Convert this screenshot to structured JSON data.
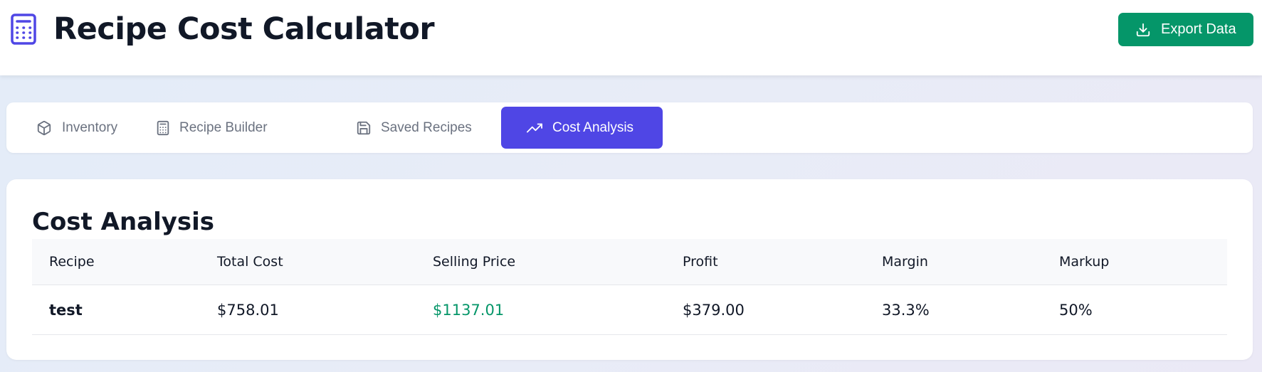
{
  "header": {
    "title": "Recipe Cost Calculator",
    "export_label": "Export Data",
    "app_icon": "calculator-icon",
    "accent_color": "#4f46e5",
    "export_color": "#059669"
  },
  "tabs": [
    {
      "label": "Inventory",
      "icon": "package-icon",
      "active": false
    },
    {
      "label": "Recipe Builder",
      "icon": "calculator-icon",
      "active": false
    },
    {
      "label": "Saved Recipes",
      "icon": "save-icon",
      "active": false
    },
    {
      "label": "Cost Analysis",
      "icon": "trending-up-icon",
      "active": true
    }
  ],
  "analysis": {
    "title": "Cost Analysis",
    "columns": [
      "Recipe",
      "Total Cost",
      "Selling Price",
      "Profit",
      "Margin",
      "Markup"
    ],
    "rows": [
      {
        "recipe": "test",
        "total_cost": "$758.01",
        "selling_price": "$1137.01",
        "profit": "$379.00",
        "margin": "33.3%",
        "markup": "50%"
      }
    ]
  }
}
